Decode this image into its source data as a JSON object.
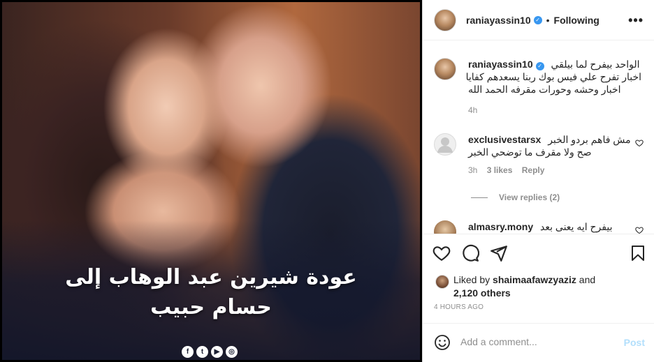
{
  "media": {
    "caption_line1": "عودة شيرين عبد الوهاب إلى",
    "caption_line2": "حسام حبيب",
    "social_icons": [
      "facebook-icon",
      "twitter-icon",
      "youtube-icon",
      "instagram-icon"
    ]
  },
  "header": {
    "username": "raniayassin10",
    "verified": true,
    "separator": "•",
    "follow_label": "Following",
    "more_label": "•••"
  },
  "comments": [
    {
      "username": "raniayassin10",
      "verified": true,
      "text_line1": "الواحد بيفرح لما بيلقي",
      "text_line2": "اخبار تفرح علي فيس بوك ربنا يسعدهم كفايا",
      "text_line3": "اخبار وحشه وحورات مقرفه الحمد الله",
      "time": "4h"
    },
    {
      "username": "exclusivestarsx",
      "text_line1": "مش فاهم بردو الخبر",
      "text_line2": "صح ولا مقرف ما توضحي الخبر",
      "time": "3h",
      "likes": "3 likes",
      "reply_label": "Reply",
      "view_replies": "View replies (2)"
    },
    {
      "username": "almasry.mony",
      "text_line1": "بيفرح ايه يعنى بعد"
    }
  ],
  "liked_by": {
    "prefix": "Liked by",
    "user": "shaimaafawzyaziz",
    "and": "and",
    "others": "2,120 others"
  },
  "timestamp": "4 HOURS AGO",
  "add_comment": {
    "placeholder": "Add a comment...",
    "post_label": "Post"
  },
  "colors": {
    "verified": "#3897f0",
    "post_disabled": "#b2dffc",
    "meta_gray": "#8e8e8e"
  }
}
